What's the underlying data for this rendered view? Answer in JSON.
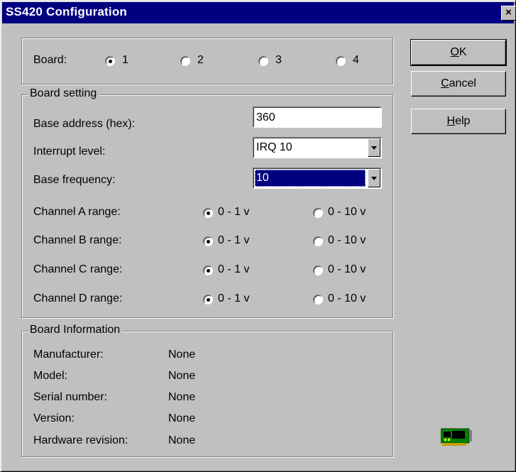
{
  "window": {
    "title": "SS420 Configuration",
    "close_glyph": "×"
  },
  "board_select": {
    "label": "Board:",
    "options": [
      "1",
      "2",
      "3",
      "4"
    ],
    "selected": "1"
  },
  "board_setting": {
    "title": "Board setting",
    "base_address_label": "Base address (hex):",
    "base_address_value": "360",
    "interrupt_label": "Interrupt level:",
    "interrupt_value": "IRQ 10",
    "frequency_label": "Base frequency:",
    "frequency_value": "10",
    "channels": [
      {
        "label": "Channel A range:",
        "opt1": "0 - 1 v",
        "opt2": "0 - 10 v",
        "selected": "0 - 1 v"
      },
      {
        "label": "Channel B range:",
        "opt1": "0 - 1 v",
        "opt2": "0 - 10 v",
        "selected": "0 - 1 v"
      },
      {
        "label": "Channel C range:",
        "opt1": "0 - 1 v",
        "opt2": "0 - 10 v",
        "selected": "0 - 1 v"
      },
      {
        "label": "Channel D range:",
        "opt1": "0 - 1 v",
        "opt2": "0 - 10 v",
        "selected": "0 - 1 v"
      }
    ]
  },
  "board_info": {
    "title": "Board Information",
    "rows": [
      {
        "label": "Manufacturer:",
        "value": "None"
      },
      {
        "label": "Model:",
        "value": "None"
      },
      {
        "label": "Serial number:",
        "value": "None"
      },
      {
        "label": "Version:",
        "value": "None"
      },
      {
        "label": "Hardware revision:",
        "value": "None"
      }
    ]
  },
  "buttons": {
    "ok": {
      "mnemonic": "O",
      "rest": "K"
    },
    "cancel": {
      "mnemonic": "C",
      "rest": "ancel"
    },
    "help": {
      "mnemonic": "H",
      "rest": "elp"
    }
  },
  "icons": {
    "board_icon": "circuit-board-icon"
  },
  "colors": {
    "titlebar": "#000080",
    "face": "#c0c0c0",
    "selection": "#000080"
  }
}
